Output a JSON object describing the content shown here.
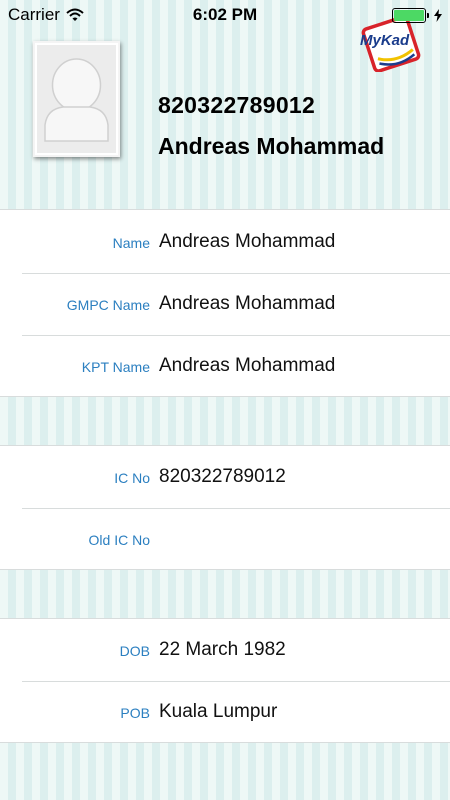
{
  "status_bar": {
    "carrier": "Carrier",
    "time": "6:02 PM"
  },
  "header": {
    "logo_text": "MyKad",
    "ic_number": "820322789012",
    "name": "Andreas Mohammad"
  },
  "sections": {
    "names": [
      {
        "label": "Name",
        "value": "Andreas Mohammad"
      },
      {
        "label": "GMPC Name",
        "value": "Andreas Mohammad"
      },
      {
        "label": "KPT Name",
        "value": "Andreas Mohammad"
      }
    ],
    "ids": [
      {
        "label": "IC No",
        "value": "820322789012"
      },
      {
        "label": "Old IC No",
        "value": ""
      }
    ],
    "birth": [
      {
        "label": "DOB",
        "value": "22 March 1982"
      },
      {
        "label": "POB",
        "value": "Kuala Lumpur"
      }
    ]
  },
  "colors": {
    "label_blue": "#2b7fc0",
    "stripe_light": "#eef8f6",
    "stripe_dark": "#dcefee",
    "battery_green": "#4cd964"
  },
  "icons": [
    "wifi-icon",
    "charging-bolt-icon",
    "avatar-placeholder-icon",
    "mykad-logo-icon"
  ]
}
